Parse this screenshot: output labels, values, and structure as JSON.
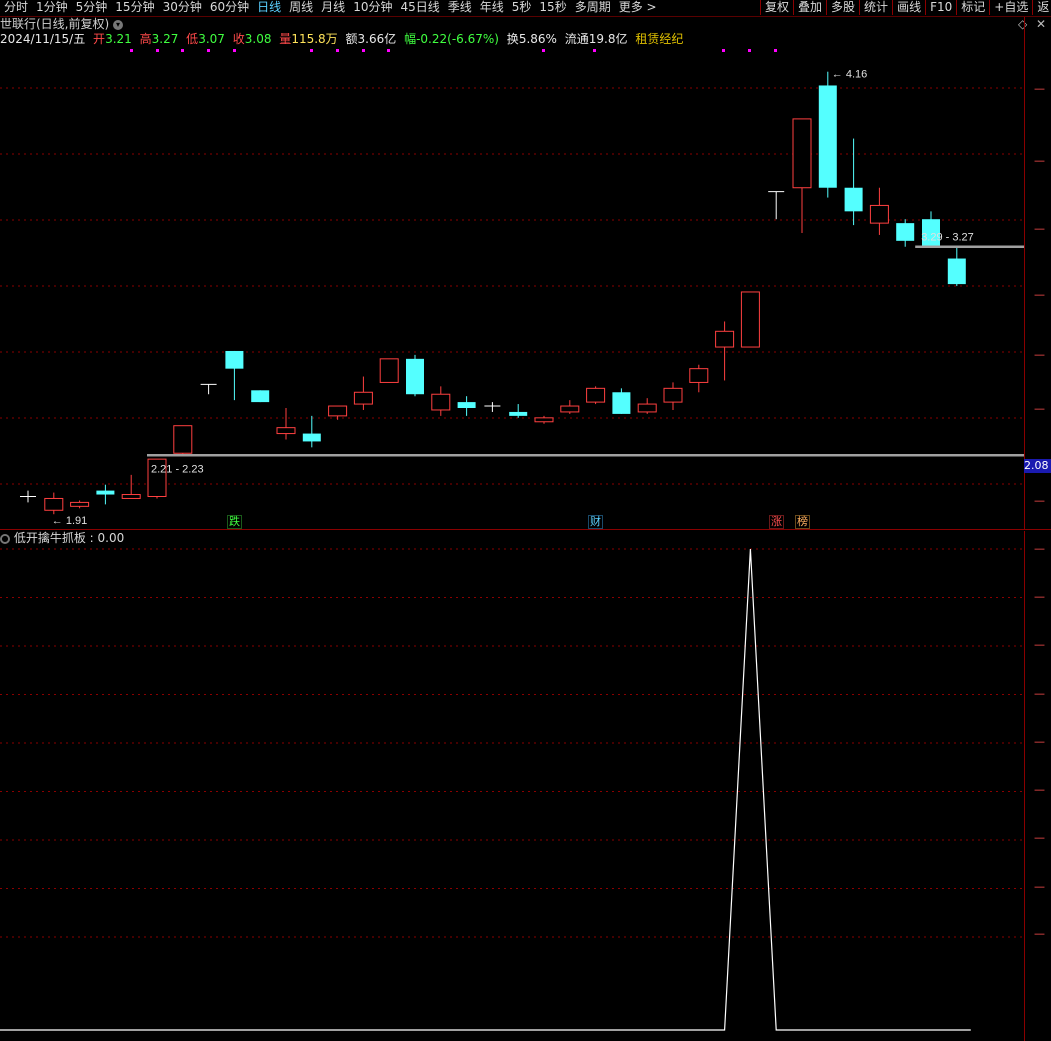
{
  "toolbar": {
    "periods": [
      "分时",
      "1分钟",
      "5分钟",
      "15分钟",
      "30分钟",
      "60分钟",
      "日线",
      "周线",
      "月线",
      "10分钟",
      "45日线",
      "季线",
      "年线",
      "5秒",
      "15秒",
      "多周期",
      "更多 >"
    ],
    "active_period": "日线",
    "tools": [
      "复权",
      "叠加",
      "多股",
      "统计",
      "画线",
      "F10",
      "标记",
      "+自选",
      "返"
    ]
  },
  "header": {
    "title": "世联行(日线,前复权)",
    "dropdown_icon": "chevron-down-icon"
  },
  "quote": {
    "date": "2024/11/15/五",
    "open_label": "开",
    "open": "3.21",
    "high_label": "高",
    "high": "3.27",
    "low_label": "低",
    "low": "3.07",
    "close_label": "收",
    "close": "3.08",
    "volume_label": "量",
    "volume": "115.8万",
    "amount_label": "额",
    "amount": "3.66亿",
    "change_label": "幅",
    "change": "-0.22(-6.67%)",
    "turnover_label": "换",
    "turnover": "5.86%",
    "float_label": "流通",
    "float_cap": "19.8亿",
    "concept": "租赁经纪"
  },
  "main_chart": {
    "high_marker": "4.16",
    "low_marker": "1.91",
    "support_label": "2.21 - 2.23",
    "resistance_label": "3.29 - 3.27",
    "current_price_tag": "2.08",
    "events": [
      "跌",
      "财",
      "涨",
      "榜"
    ]
  },
  "indicator": {
    "name": "低开擒牛抓板",
    "value": "0.00"
  },
  "colors": {
    "up": "#ff4040",
    "down": "#54ffff",
    "neutral": "#ffffff",
    "grid": "#8a0000",
    "support_line": "#a0a0a0",
    "marker": "#ff00ff"
  },
  "chart_data": {
    "type": "candlestick",
    "candles": [
      {
        "o": 2.0,
        "c": 2.0,
        "h": 2.03,
        "l": 1.97,
        "dir": "flat"
      },
      {
        "o": 1.93,
        "c": 1.99,
        "h": 2.02,
        "l": 1.91,
        "dir": "up"
      },
      {
        "o": 1.95,
        "c": 1.97,
        "h": 1.98,
        "l": 1.94,
        "dir": "up"
      },
      {
        "o": 2.03,
        "c": 2.01,
        "h": 2.06,
        "l": 1.96,
        "dir": "down"
      },
      {
        "o": 1.99,
        "c": 2.01,
        "h": 2.11,
        "l": 1.99,
        "dir": "up"
      },
      {
        "o": 2.0,
        "c": 2.19,
        "h": 2.19,
        "l": 1.99,
        "dir": "up"
      },
      {
        "o": 2.22,
        "c": 2.36,
        "h": 2.36,
        "l": 2.21,
        "dir": "up"
      },
      {
        "o": 2.57,
        "c": 2.57,
        "h": 2.57,
        "l": 2.52,
        "dir": "flat"
      },
      {
        "o": 2.74,
        "c": 2.65,
        "h": 2.74,
        "l": 2.49,
        "dir": "down"
      },
      {
        "o": 2.54,
        "c": 2.48,
        "h": 2.54,
        "l": 2.48,
        "dir": "down"
      },
      {
        "o": 2.32,
        "c": 2.35,
        "h": 2.45,
        "l": 2.29,
        "dir": "up"
      },
      {
        "o": 2.32,
        "c": 2.28,
        "h": 2.41,
        "l": 2.25,
        "dir": "down"
      },
      {
        "o": 2.41,
        "c": 2.46,
        "h": 2.46,
        "l": 2.39,
        "dir": "up"
      },
      {
        "o": 2.47,
        "c": 2.53,
        "h": 2.61,
        "l": 2.44,
        "dir": "up"
      },
      {
        "o": 2.58,
        "c": 2.7,
        "h": 2.7,
        "l": 2.58,
        "dir": "up"
      },
      {
        "o": 2.7,
        "c": 2.52,
        "h": 2.72,
        "l": 2.51,
        "dir": "down"
      },
      {
        "o": 2.44,
        "c": 2.52,
        "h": 2.56,
        "l": 2.41,
        "dir": "up"
      },
      {
        "o": 2.48,
        "c": 2.45,
        "h": 2.51,
        "l": 2.41,
        "dir": "down"
      },
      {
        "o": 2.46,
        "c": 2.46,
        "h": 2.48,
        "l": 2.43,
        "dir": "flat"
      },
      {
        "o": 2.43,
        "c": 2.41,
        "h": 2.47,
        "l": 2.4,
        "dir": "down"
      },
      {
        "o": 2.38,
        "c": 2.4,
        "h": 2.41,
        "l": 2.37,
        "dir": "up"
      },
      {
        "o": 2.43,
        "c": 2.46,
        "h": 2.49,
        "l": 2.42,
        "dir": "up"
      },
      {
        "o": 2.48,
        "c": 2.55,
        "h": 2.56,
        "l": 2.47,
        "dir": "up"
      },
      {
        "o": 2.53,
        "c": 2.42,
        "h": 2.55,
        "l": 2.42,
        "dir": "down"
      },
      {
        "o": 2.43,
        "c": 2.47,
        "h": 2.5,
        "l": 2.42,
        "dir": "up"
      },
      {
        "o": 2.48,
        "c": 2.55,
        "h": 2.58,
        "l": 2.44,
        "dir": "up"
      },
      {
        "o": 2.58,
        "c": 2.65,
        "h": 2.67,
        "l": 2.53,
        "dir": "up"
      },
      {
        "o": 2.76,
        "c": 2.84,
        "h": 2.89,
        "l": 2.59,
        "dir": "up"
      },
      {
        "o": 2.76,
        "c": 3.04,
        "h": 3.04,
        "l": 2.76,
        "dir": "up"
      },
      {
        "o": 3.55,
        "c": 3.55,
        "h": 3.55,
        "l": 3.41,
        "dir": "flat"
      },
      {
        "o": 3.57,
        "c": 3.92,
        "h": 3.92,
        "l": 3.34,
        "dir": "up"
      },
      {
        "o": 4.09,
        "c": 3.57,
        "h": 4.16,
        "l": 3.52,
        "dir": "down"
      },
      {
        "o": 3.57,
        "c": 3.45,
        "h": 3.82,
        "l": 3.38,
        "dir": "down"
      },
      {
        "o": 3.39,
        "c": 3.48,
        "h": 3.57,
        "l": 3.33,
        "dir": "up"
      },
      {
        "o": 3.39,
        "c": 3.3,
        "h": 3.41,
        "l": 3.27,
        "dir": "down"
      },
      {
        "o": 3.41,
        "c": 3.27,
        "h": 3.45,
        "l": 3.27,
        "dir": "down"
      },
      {
        "o": 3.21,
        "c": 3.08,
        "h": 3.27,
        "l": 3.07,
        "dir": "down"
      }
    ],
    "indicator_values": [
      0,
      0,
      0,
      0,
      0,
      0,
      0,
      0,
      0,
      0,
      0,
      0,
      0,
      0,
      0,
      0,
      0,
      0,
      0,
      0,
      0,
      0,
      0,
      0,
      0,
      0,
      0,
      0,
      1,
      0,
      0,
      0,
      0,
      0,
      0,
      0,
      0
    ],
    "support": [
      2.21,
      2.23
    ],
    "resistance": [
      3.29,
      3.27
    ],
    "ylim": [
      1.85,
      4.25
    ]
  }
}
